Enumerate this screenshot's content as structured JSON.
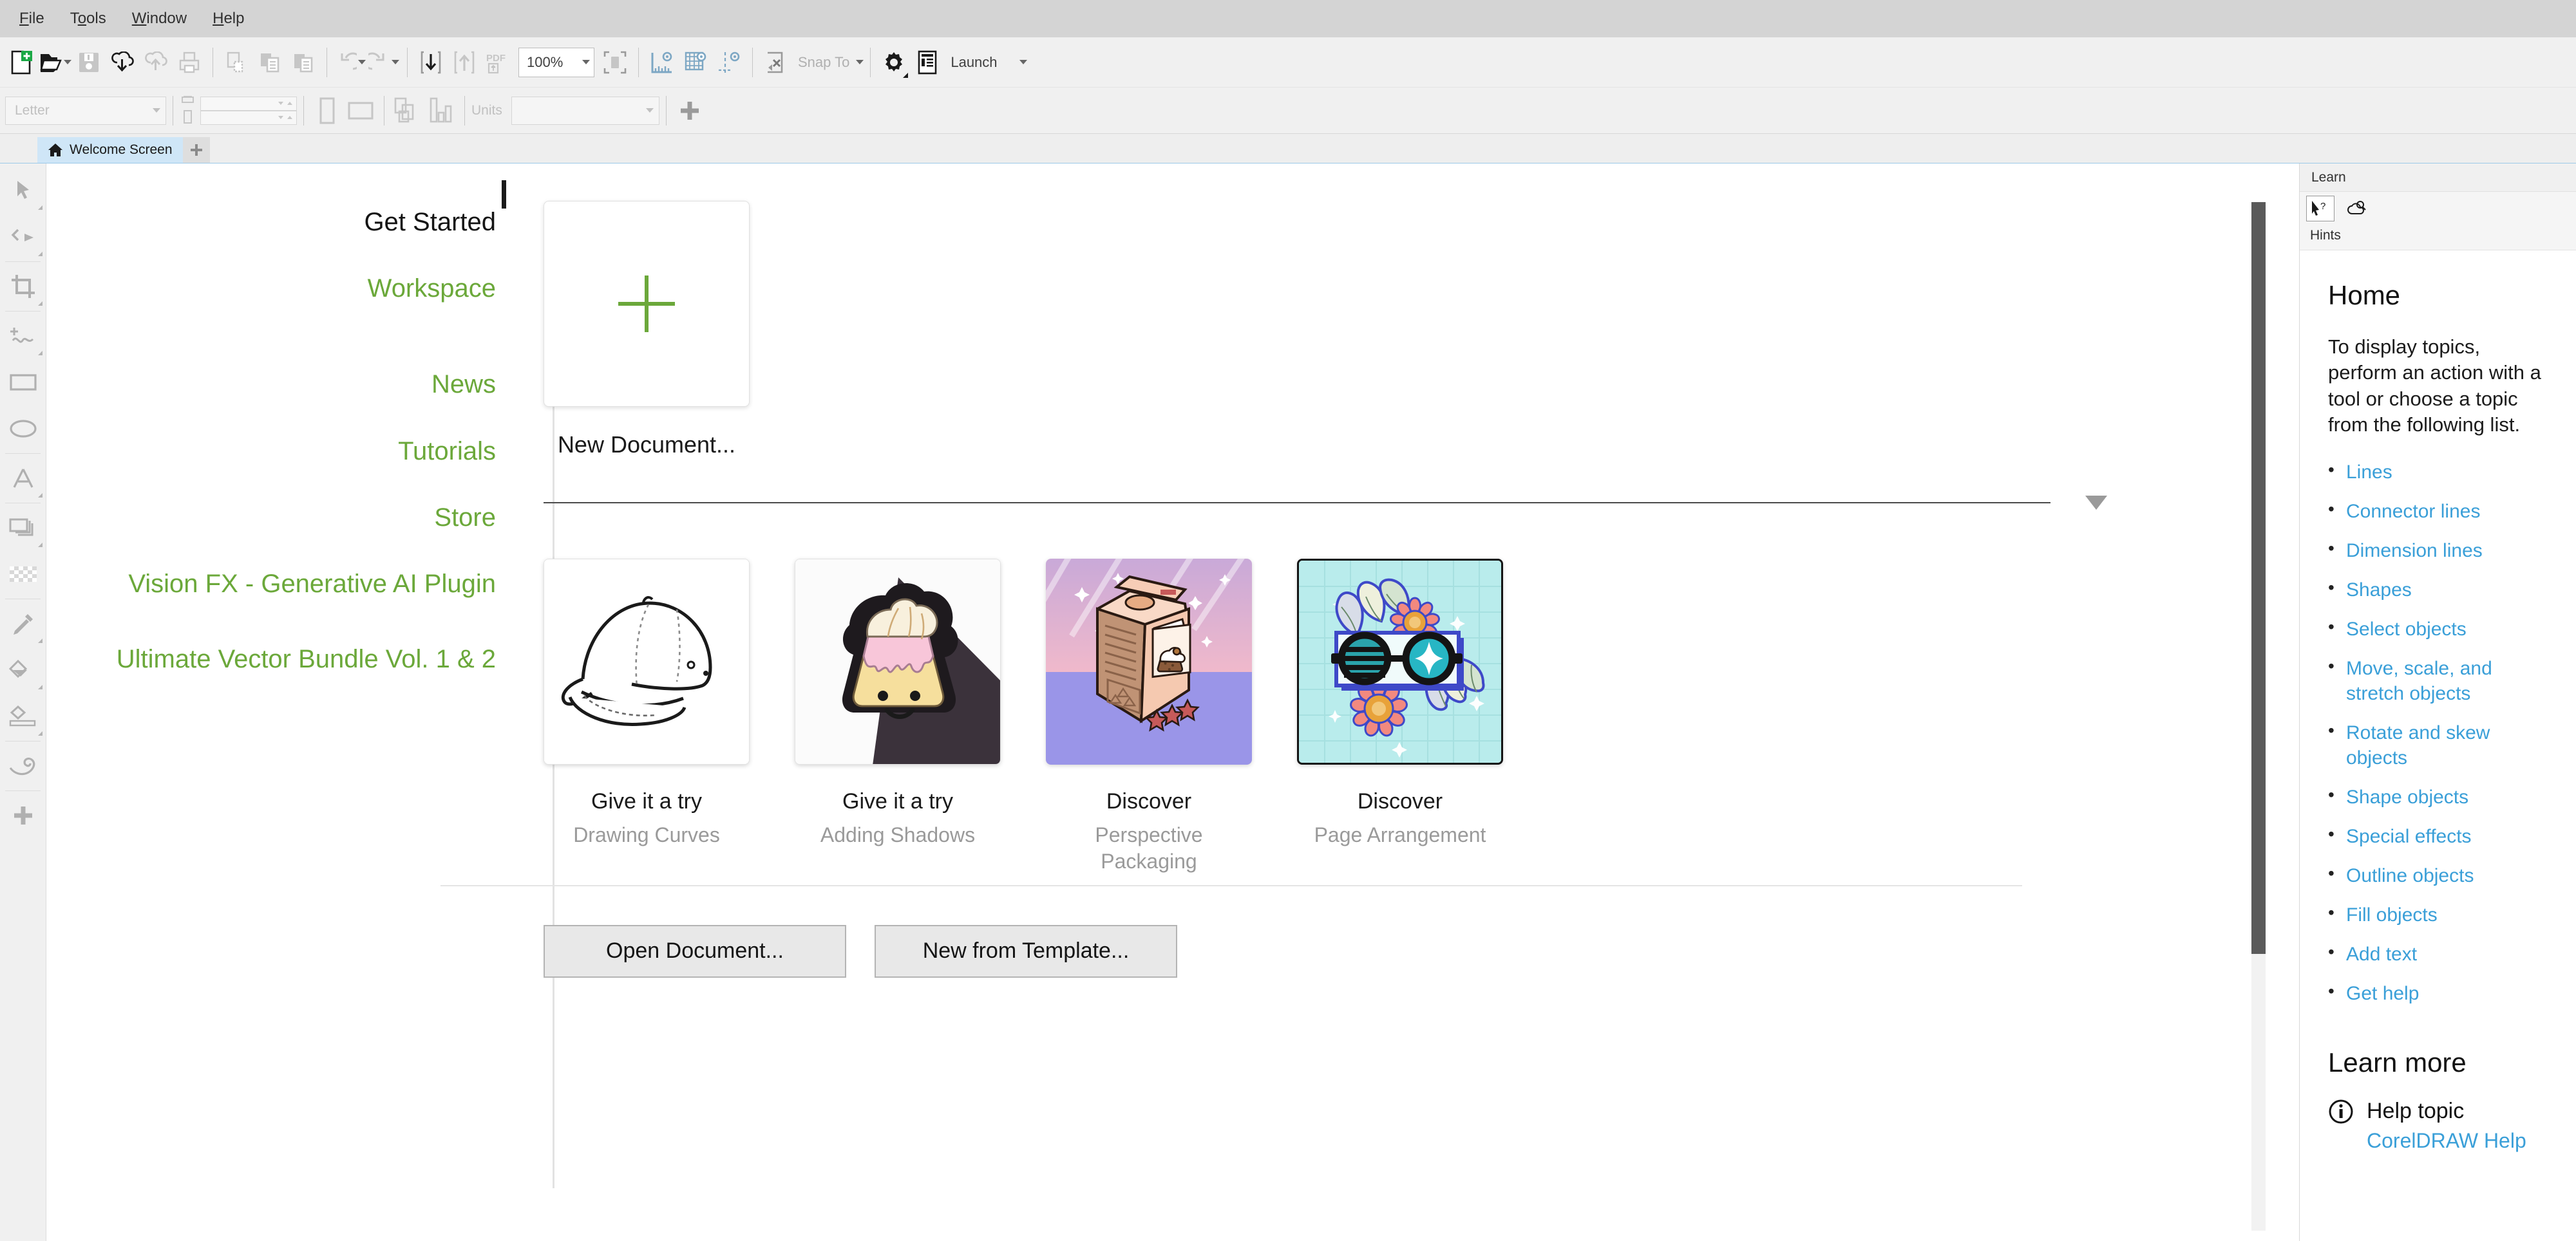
{
  "menubar": {
    "items": [
      {
        "pre": "",
        "u": "F",
        "post": "ile"
      },
      {
        "pre": "T",
        "u": "o",
        "post": "ols"
      },
      {
        "pre": "",
        "u": "W",
        "post": "indow"
      },
      {
        "pre": "",
        "u": "H",
        "post": "elp"
      }
    ]
  },
  "toolbar": {
    "zoom_level": "100%",
    "snap_to_label": "Snap To",
    "launch_label": "Launch",
    "page_size": "Letter",
    "units_label": "Units"
  },
  "tabbar": {
    "tab_label": "Welcome Screen"
  },
  "nav": {
    "items": [
      {
        "label": "Get Started",
        "active": true
      },
      {
        "label": "Workspace",
        "active": false
      },
      {
        "label": "News",
        "active": false
      },
      {
        "label": "Tutorials",
        "active": false
      },
      {
        "label": "Store",
        "active": false
      },
      {
        "label": "Vision FX - Generative AI Plugin",
        "active": false
      },
      {
        "label": "Ultimate Vector Bundle Vol. 1 & 2",
        "active": false
      }
    ]
  },
  "main": {
    "new_document_label": "New Document...",
    "cards": [
      {
        "title": "Give it a try",
        "subtitle": "Drawing Curves"
      },
      {
        "title": "Give it a try",
        "subtitle": "Adding Shadows"
      },
      {
        "title": "Discover",
        "subtitle": "Perspective Packaging"
      },
      {
        "title": "Discover",
        "subtitle": "Page Arrangement"
      }
    ],
    "buttons": {
      "open_document": "Open Document...",
      "new_from_template": "New from Template..."
    }
  },
  "dock": {
    "title": "Learn",
    "hints_label": "Hints",
    "heading": "Home",
    "description": "To display topics, perform an action with a tool or choose a topic from the following list.",
    "topics": [
      "Lines",
      "Connector lines",
      "Dimension lines",
      "Shapes",
      "Select objects",
      "Move, scale, and stretch objects",
      "Rotate and skew objects",
      "Shape objects",
      "Special effects",
      "Outline objects",
      "Fill objects",
      "Add text",
      "Get help"
    ],
    "learn_more_heading": "Learn more",
    "help_topic_title": "Help topic",
    "help_topic_link": "CorelDRAW Help"
  },
  "colors": {
    "accent_green": "#6ba83a",
    "link_blue": "#3a9fd8",
    "tab_active": "#cfe6f7"
  }
}
